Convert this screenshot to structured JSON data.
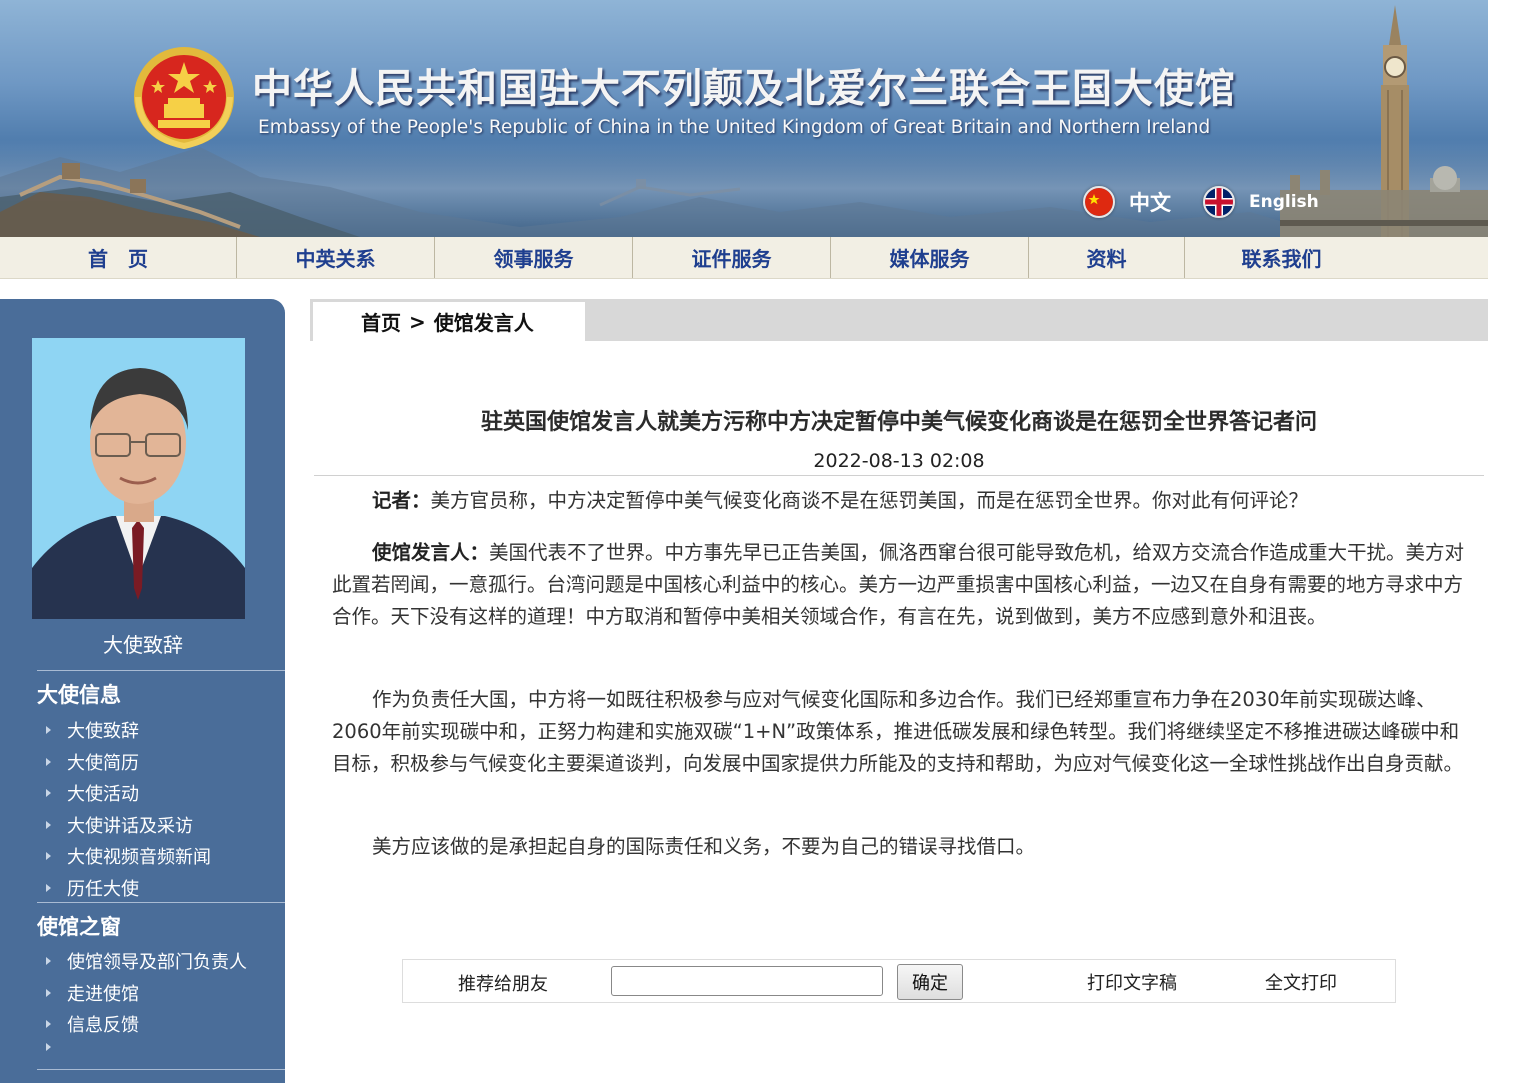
{
  "banner": {
    "title_cn": "中华人民共和国驻大不列颠及北爱尔兰联合王国大使馆",
    "title_en": "Embassy of the People's Republic of China in the United Kingdom of Great Britain and Northern Ireland",
    "lang_cn": "中文",
    "lang_en": "English"
  },
  "nav": {
    "items": [
      {
        "label": "首　页"
      },
      {
        "label": "中英关系"
      },
      {
        "label": "领事服务"
      },
      {
        "label": "证件服务"
      },
      {
        "label": "媒体服务"
      },
      {
        "label": "资料"
      },
      {
        "label": "联系我们"
      }
    ]
  },
  "sidebar": {
    "photo_caption": "大使致辞",
    "section1": {
      "heading": "大使信息",
      "items": [
        {
          "label": "大使致辞"
        },
        {
          "label": "大使简历"
        },
        {
          "label": "大使活动"
        },
        {
          "label": "大使讲话及采访"
        },
        {
          "label": "大使视频音频新闻"
        },
        {
          "label": "历任大使"
        }
      ]
    },
    "section2": {
      "heading": "使馆之窗",
      "items": [
        {
          "label": "使馆领导及部门负责人"
        },
        {
          "label": "走进使馆"
        },
        {
          "label": "信息反馈"
        },
        {
          "label": ""
        }
      ]
    }
  },
  "breadcrumb": {
    "home": "首页",
    "separator": ">",
    "current": "使馆发言人"
  },
  "article": {
    "title": "驻英国使馆发言人就美方污称中方决定暂停中美气候变化商谈是在惩罚全世界答记者问",
    "date": "2022-08-13 02:08",
    "p1_speaker": "记者：",
    "p1_text": "美方官员称，中方决定暂停中美气候变化商谈不是在惩罚美国，而是在惩罚全世界。你对此有何评论？",
    "p2_speaker": "使馆发言人：",
    "p2_text": "美国代表不了世界。中方事先早已正告美国，佩洛西窜台很可能导致危机，给双方交流合作造成重大干扰。美方对此置若罔闻，一意孤行。台湾问题是中国核心利益中的核心。美方一边严重损害中国核心利益，一边又在自身有需要的地方寻求中方合作。天下没有这样的道理！中方取消和暂停中美相关领域合作，有言在先，说到做到，美方不应感到意外和沮丧。",
    "p3_text": "作为负责任大国，中方将一如既往积极参与应对气候变化国际和多边合作。我们已经郑重宣布力争在2030年前实现碳达峰、2060年前实现碳中和，正努力构建和实施双碳“1+N”政策体系，推进低碳发展和绿色转型。我们将继续坚定不移推进碳达峰碳中和目标，积极参与气候变化主要渠道谈判，向发展中国家提供力所能及的支持和帮助，为应对气候变化这一全球性挑战作出自身贡献。",
    "p4_text": "美方应该做的是承担起自身的国际责任和义务，不要为自己的错误寻找借口。"
  },
  "tools": {
    "recommend_label": "推荐给朋友",
    "recommend_value": "",
    "confirm_label": "确定",
    "print_draft": "打印文字稿",
    "print_all": "全文打印"
  },
  "colors": {
    "nav_text": "#1f3f8f",
    "sidebar_bg": "#4a6d99",
    "nav_bg": "#f2efe4",
    "crumb_bar": "#d8d8d8"
  }
}
